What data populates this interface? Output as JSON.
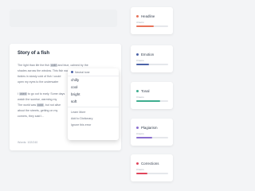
{
  "document": {
    "title": "Story of a fish",
    "paragraphs": [
      [
        "The light than life the fish ",
        "cold",
        " and blue, calmed by the"
      ],
      [
        "shades across the window. This ",
        "",
        "fish was not"
      ],
      [
        "tickles in slowly cold of fish I could"
      ],
      [
        "open my eyes to the underwater"
      ],
      [
        "",
        "",
        ""
      ],
      [
        "I ",
        "used",
        " to go out to early. Some days"
      ],
      [
        "watch the sunrise, warming my"
      ],
      [
        "The world was ",
        "cold",
        ", but not alive"
      ],
      [
        "about the streets, getting on my"
      ],
      [
        "corners, they said I..."
      ]
    ],
    "footer": "Words: 102/240"
  },
  "popup": {
    "header": "Neutral tone",
    "options": [
      "chilly",
      "cool",
      "bright",
      "soft"
    ],
    "actions": [
      "Learn More",
      "Add to Dictionary",
      "Ignore this error"
    ]
  },
  "cards": [
    {
      "title": "Headline",
      "subtitle": "4 items",
      "color": "#e8735a",
      "fill": 0.55
    },
    {
      "title": "Emotion",
      "subtitle": "3 items",
      "color": "#4c63a8",
      "fill": 0.4
    },
    {
      "title": "Tonal",
      "subtitle": "3 items",
      "color": "#3fae8f",
      "fill": 0.75
    },
    {
      "title": "Plagiarism",
      "subtitle": "3 items",
      "color": "#8b6fd0",
      "fill": 0.5
    },
    {
      "title": "Corrections",
      "subtitle": "3 items",
      "color": "#e0455b",
      "fill": 0.35
    }
  ]
}
